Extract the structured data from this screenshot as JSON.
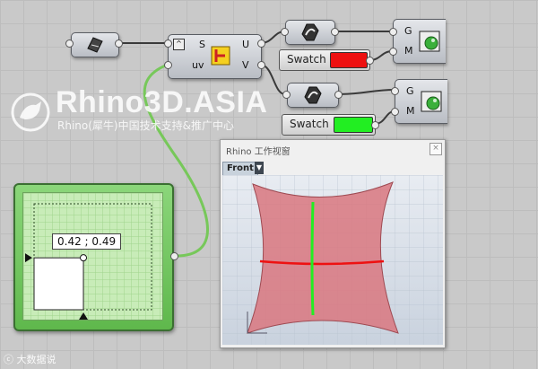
{
  "watermark": {
    "title": "Rhino3D.ASIA",
    "subtitle": "Rhino(犀牛)中国技术支持&推广中心"
  },
  "components": {
    "surface_param": {
      "icon": "surface-param-icon"
    },
    "evaluate": {
      "input_s": "S",
      "input_uv": "uv",
      "output_u": "U",
      "output_v": "V"
    },
    "curve_top": {
      "icon": "curve-param-icon"
    },
    "curve_bottom": {
      "icon": "curve-param-icon"
    },
    "preview_top": {
      "input_g": "G",
      "input_m": "M"
    },
    "preview_bottom": {
      "input_g": "G",
      "input_m": "M"
    }
  },
  "swatch_top": {
    "label": "Swatch",
    "color": "#ee1111"
  },
  "swatch_bottom": {
    "label": "Swatch",
    "color": "#22ee22"
  },
  "md_slider": {
    "value_text": "0.42 ; 0.49",
    "value_u": 0.42,
    "value_v": 0.49
  },
  "viewport": {
    "title": "Rhino 工作视窗",
    "view_name": "Front",
    "surface_color": "#d9777f",
    "u_curve_color": "#ee1111",
    "v_curve_color": "#22ee22"
  },
  "footer": {
    "text": "大数据说"
  }
}
